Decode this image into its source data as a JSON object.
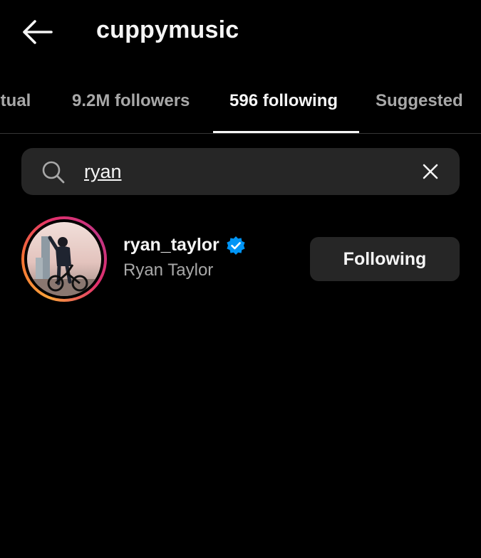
{
  "header": {
    "back_icon": "arrow-left-icon",
    "title": "cuppymusic"
  },
  "tabs": [
    {
      "label": "utual",
      "active": false
    },
    {
      "label": "9.2M followers",
      "active": false
    },
    {
      "label": "596 following",
      "active": true
    },
    {
      "label": "Suggested",
      "active": false
    }
  ],
  "search": {
    "icon": "search-icon",
    "value": "ryan",
    "clear_icon": "close-icon"
  },
  "results": [
    {
      "username": "ryan_taylor",
      "verified": true,
      "full_name": "Ryan Taylor",
      "button_label": "Following"
    }
  ],
  "colors": {
    "background": "#000000",
    "surface": "#262626",
    "text_primary": "#f5f5f5",
    "text_secondary": "#a8a8a8",
    "verified_blue": "#0095f6"
  }
}
